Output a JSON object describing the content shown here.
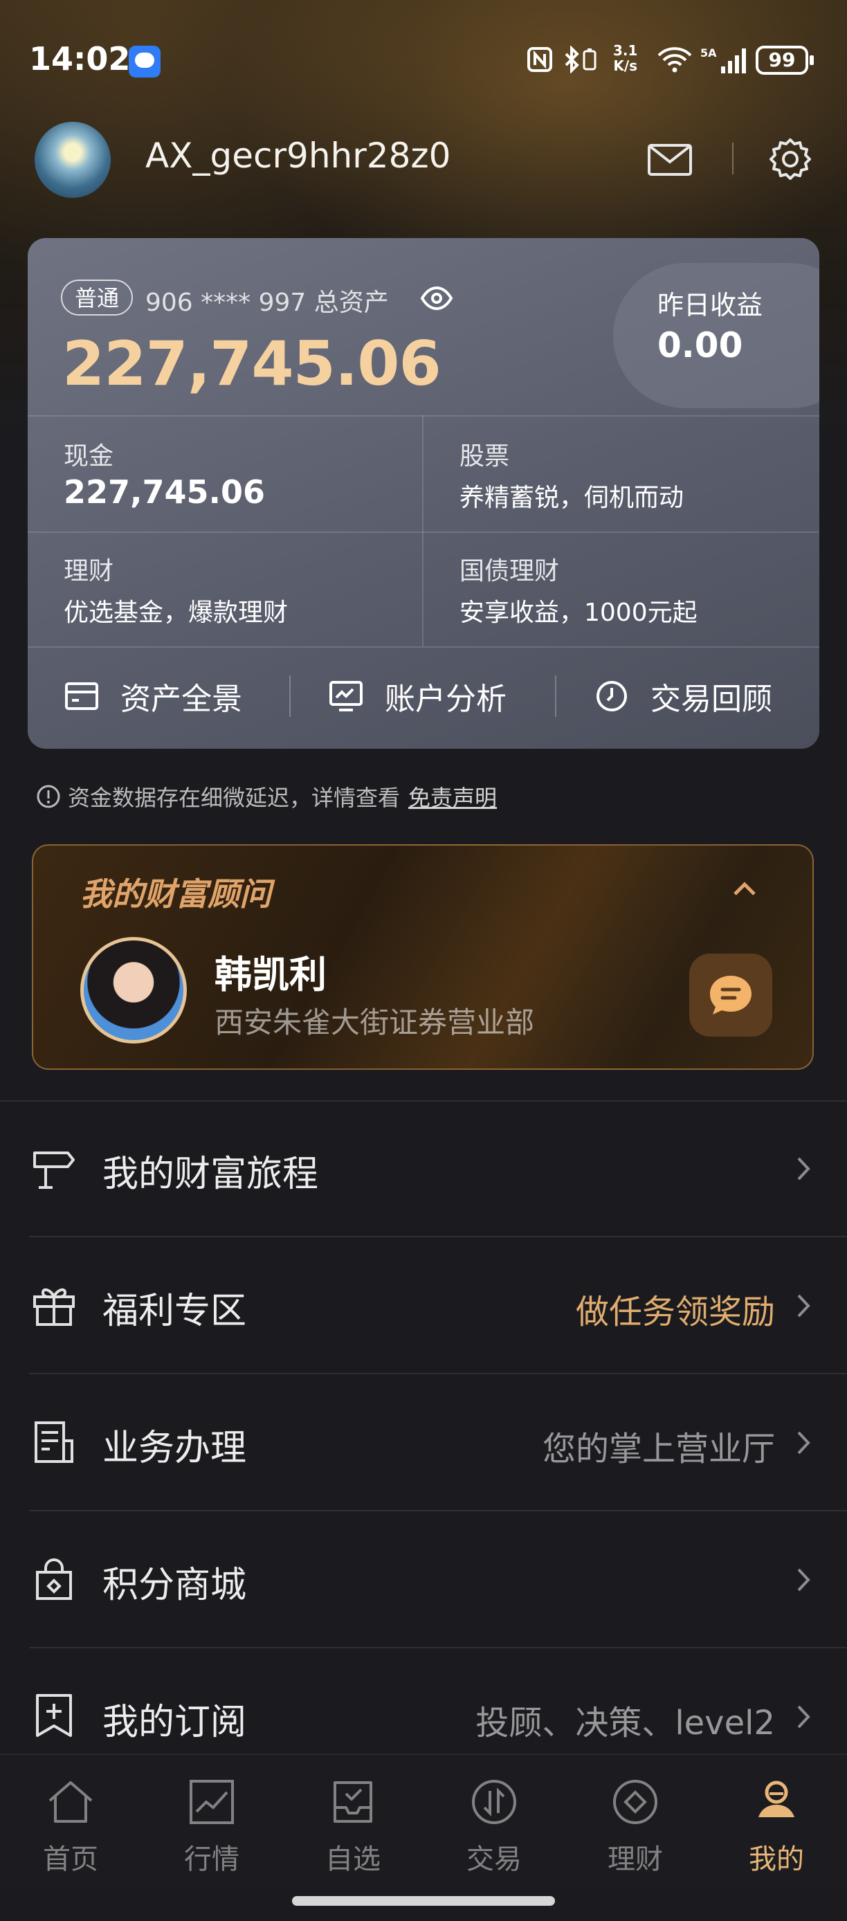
{
  "status_bar": {
    "time": "14:02",
    "speed_value": "3.1",
    "speed_unit": "K/s",
    "network": "5A",
    "battery": "99"
  },
  "header": {
    "username": "AX_gecr9hhr28z0"
  },
  "asset_card": {
    "tag": "普通",
    "account_masked": "906 **** 997 总资产",
    "total_assets": "227,745.06",
    "yesterday_label": "昨日收益",
    "yesterday_value": "0.00",
    "cells": [
      {
        "label": "现金",
        "value": "227,745.06"
      },
      {
        "label": "股票",
        "value": "养精蓄锐，伺机而动"
      },
      {
        "label": "理财",
        "value": "优选基金，爆款理财"
      },
      {
        "label": "国债理财",
        "value": "安享收益，1000元起"
      }
    ],
    "actions": [
      {
        "label": "资产全景",
        "icon": "wallet-icon"
      },
      {
        "label": "账户分析",
        "icon": "monitor-chart-icon"
      },
      {
        "label": "交易回顾",
        "icon": "clock-icon"
      }
    ]
  },
  "disclaimer": {
    "text": "资金数据存在细微延迟，详情查看",
    "link": "免责声明"
  },
  "advisor": {
    "title": "我的财富顾问",
    "name": "韩凯利",
    "branch": "西安朱雀大街证券营业部"
  },
  "menu": [
    {
      "label": "我的财富旅程",
      "right": "",
      "icon": "signpost-icon"
    },
    {
      "label": "福利专区",
      "right": "做任务领奖励",
      "icon": "gift-icon"
    },
    {
      "label": "业务办理",
      "right": "您的掌上营业厅",
      "icon": "document-icon"
    },
    {
      "label": "积分商城",
      "right": "",
      "icon": "shopping-bag-icon"
    },
    {
      "label": "我的订阅",
      "right": "投顾、决策、level2",
      "icon": "bookmark-plus-icon"
    }
  ],
  "bottom_nav": [
    {
      "label": "首页",
      "icon": "home-icon"
    },
    {
      "label": "行情",
      "icon": "chart-icon"
    },
    {
      "label": "自选",
      "icon": "inbox-check-icon"
    },
    {
      "label": "交易",
      "icon": "exchange-icon"
    },
    {
      "label": "理财",
      "icon": "diamond-icon"
    },
    {
      "label": "我的",
      "icon": "user-icon",
      "active": true
    }
  ],
  "colors": {
    "gold_accent": "#e8b678",
    "asset_total": "#f6d1a0",
    "background": "#1b1b1f"
  }
}
